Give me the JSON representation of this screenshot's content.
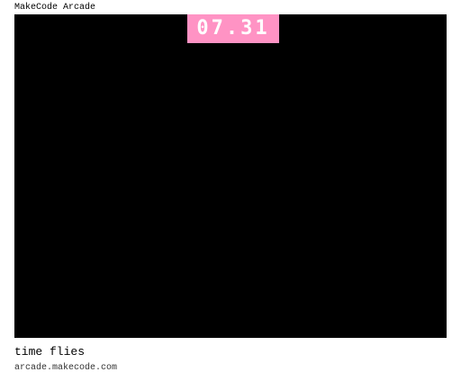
{
  "app": {
    "title": "MakeCode Arcade"
  },
  "game": {
    "timer": "07.31",
    "timer_color": "#ff93c4",
    "screen_color": "#000000"
  },
  "footer": {
    "game_name": "time flies",
    "url": "arcade.makecode.com"
  }
}
